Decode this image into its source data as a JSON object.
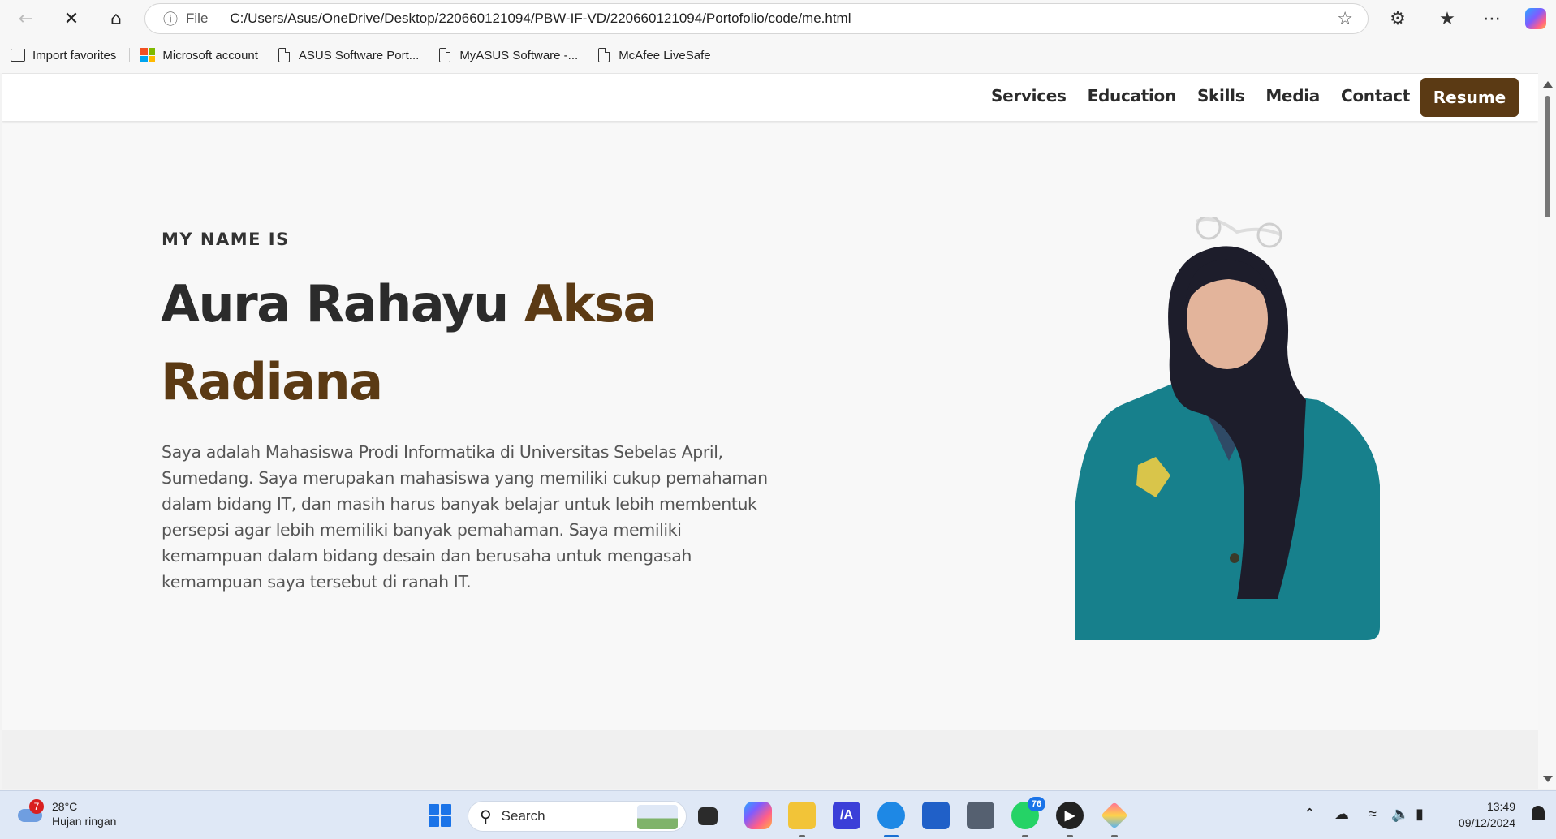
{
  "browser": {
    "address": {
      "info_label": "File",
      "url": "C:/Users/Asus/OneDrive/Desktop/220660121094/PBW-IF-VD/220660121094/Portofolio/code/me.html"
    },
    "favorites": [
      {
        "label": "Import favorites",
        "icon": "import-icon"
      },
      {
        "label": "Microsoft account",
        "icon": "microsoft-logo"
      },
      {
        "label": "ASUS Software Port...",
        "icon": "page-icon"
      },
      {
        "label": "MyASUS Software -...",
        "icon": "page-icon"
      },
      {
        "label": "McAfee LiveSafe",
        "icon": "page-icon"
      }
    ]
  },
  "site": {
    "nav": {
      "links": [
        "Services",
        "Education",
        "Skills",
        "Media",
        "Contact"
      ],
      "resume": "Resume"
    },
    "hero": {
      "subtitle": "MY NAME IS",
      "name_first": "Aura Rahayu ",
      "name_accent": "Aksa Radiana",
      "description": "Saya adalah Mahasiswa Prodi Informatika di Universitas Sebelas April, Sumedang. Saya merupakan mahasiswa yang memiliki cukup pemahaman dalam bidang IT, dan masih harus banyak belajar untuk lebih membentuk persepsi agar lebih memiliki banyak pemahaman. Saya memiliki kemampuan dalam bidang desain dan berusaha untuk mengasah kemampuan saya tersebut di ranah IT."
    },
    "colors": {
      "accent": "#5b3a14",
      "text": "#2b2b2b",
      "background": "#f8f8f8"
    }
  },
  "taskbar": {
    "weather": {
      "badge": "7",
      "temp": "28°C",
      "condition": "Hujan ringan"
    },
    "search_placeholder": "Search",
    "whatsapp_badge": "76",
    "clock": {
      "time": "13:49",
      "date": "09/12/2024"
    }
  }
}
